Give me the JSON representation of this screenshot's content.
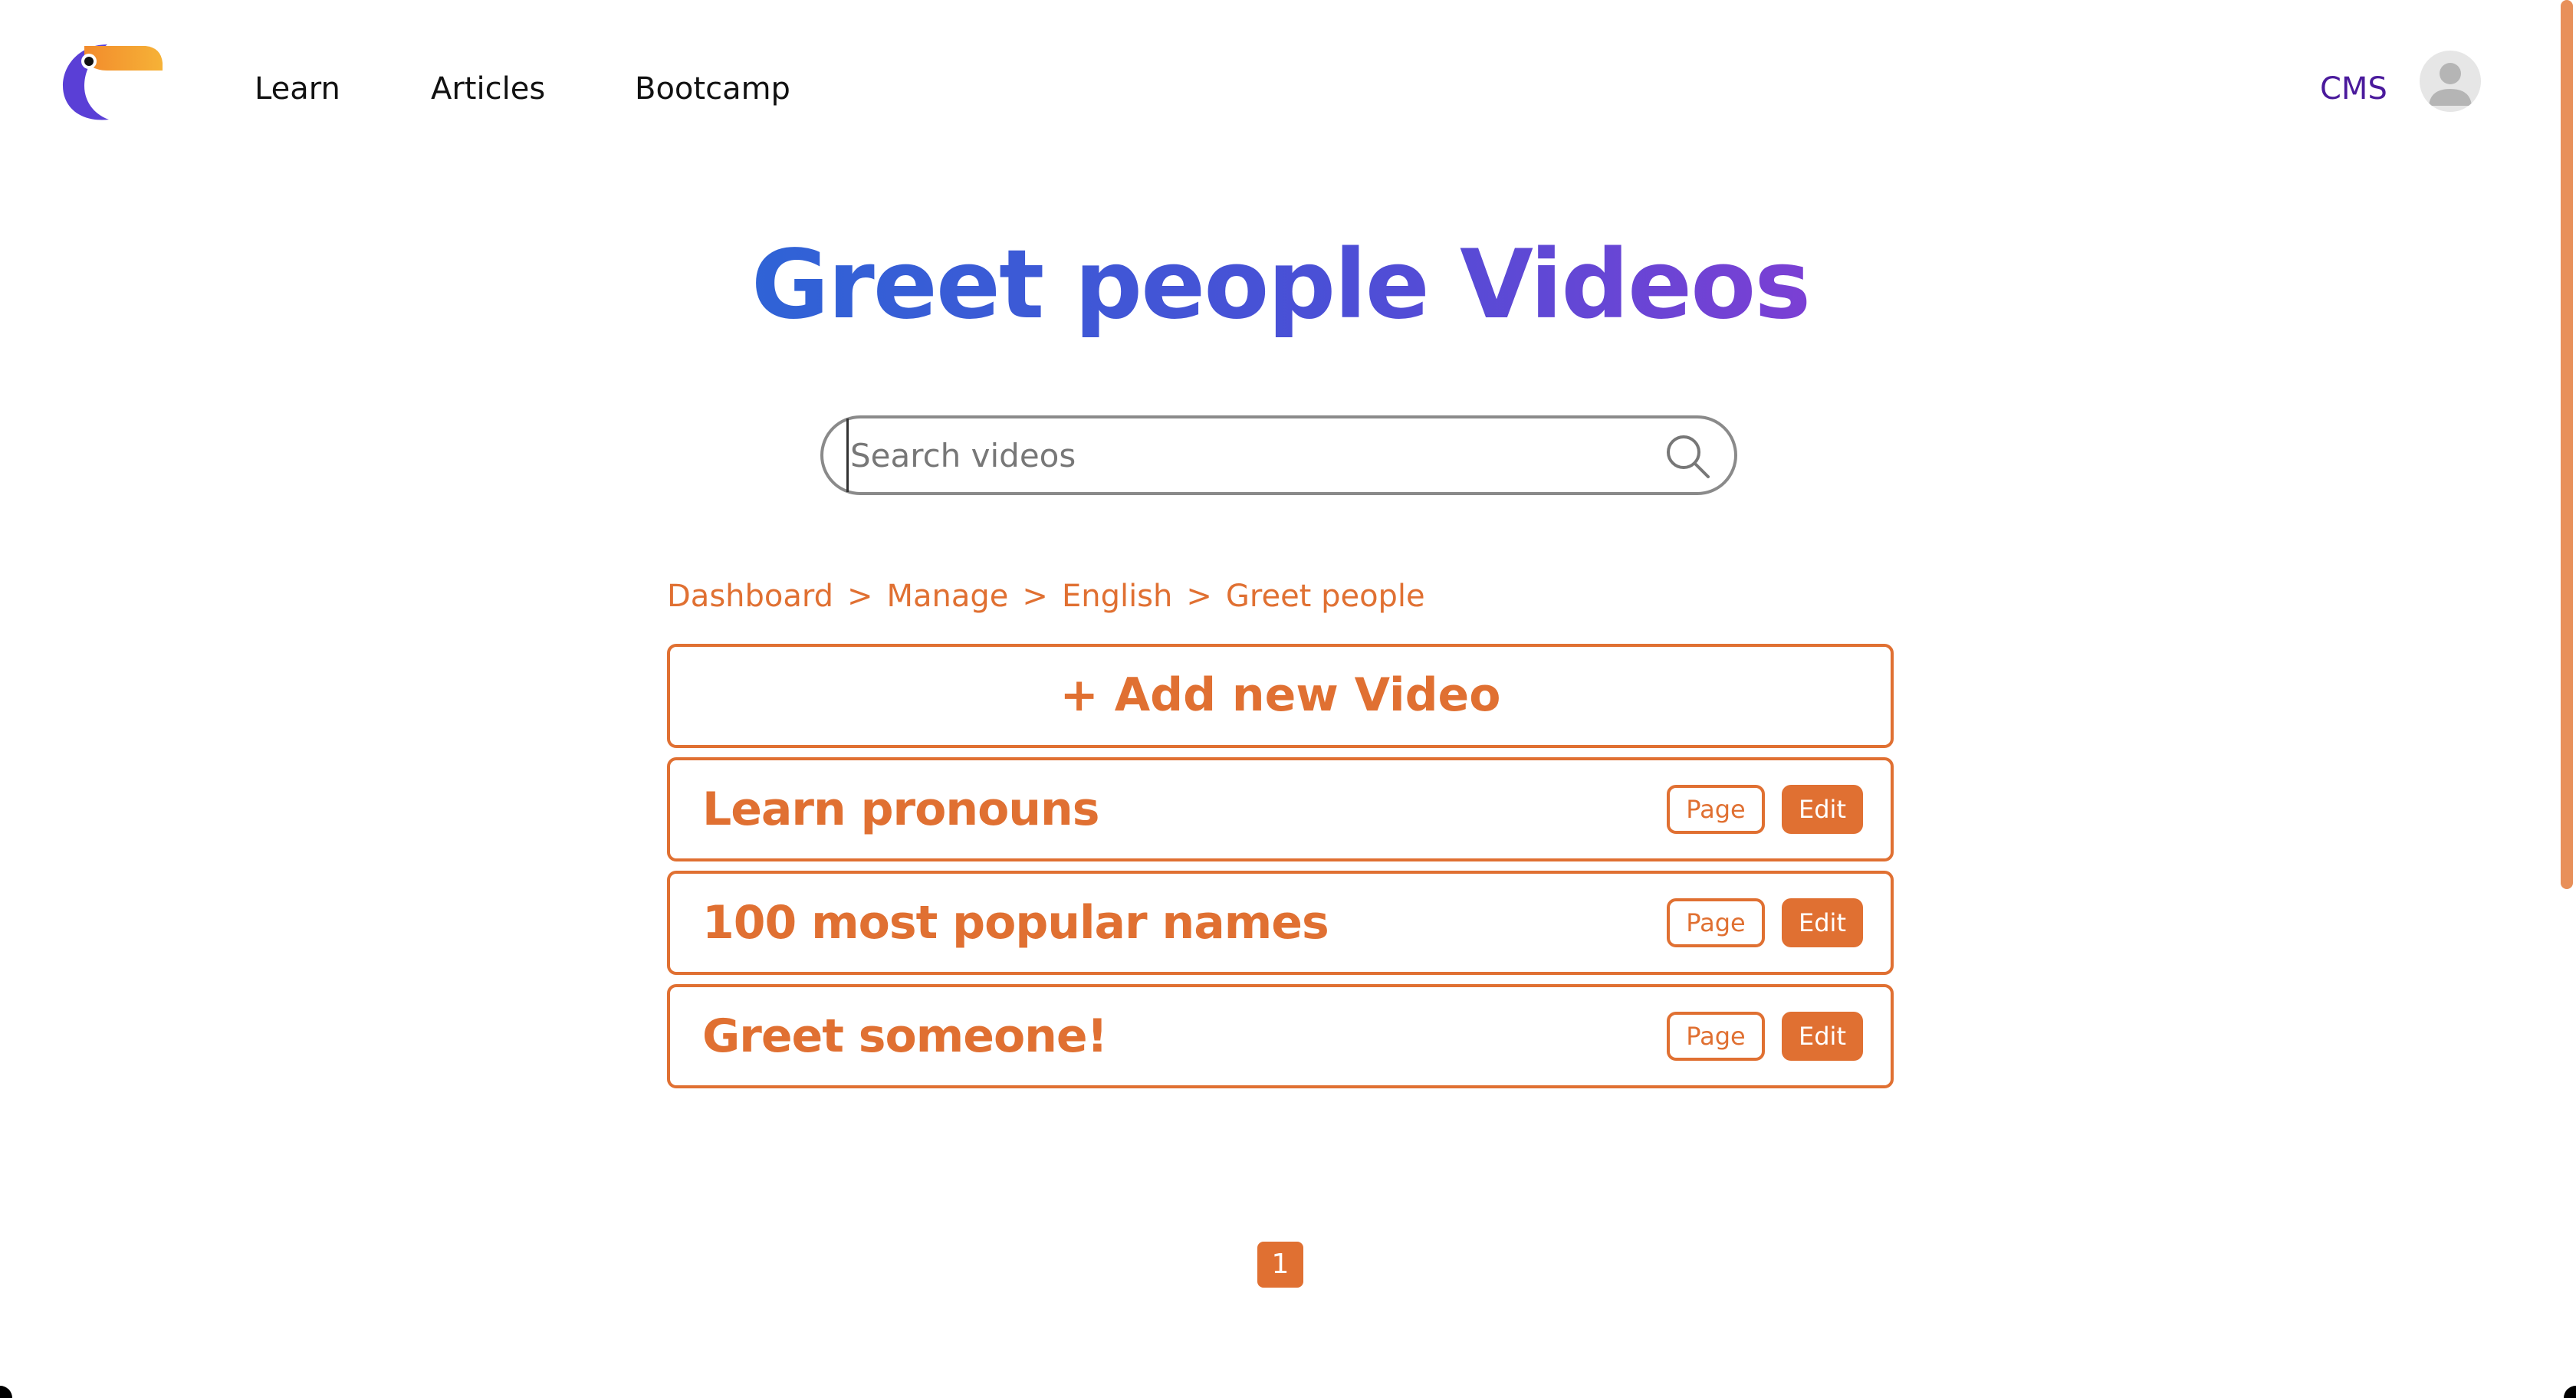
{
  "header": {
    "logo_icon": "toucan-logo-icon",
    "nav": [
      "Learn",
      "Articles",
      "Bootcamp"
    ],
    "cms_label": "CMS",
    "avatar_icon": "user-avatar-icon"
  },
  "title": "Greet people Videos",
  "search": {
    "placeholder": "Search videos",
    "value": "",
    "icon": "search-icon"
  },
  "breadcrumb": [
    "Dashboard",
    "Manage",
    "English",
    "Greet people"
  ],
  "breadcrumb_separator": ">",
  "add_button_label": "+ Add new Video",
  "videos": [
    {
      "title": "Learn pronouns",
      "page_label": "Page",
      "edit_label": "Edit"
    },
    {
      "title": "100 most popular names",
      "page_label": "Page",
      "edit_label": "Edit"
    },
    {
      "title": "Greet someone!",
      "page_label": "Page",
      "edit_label": "Edit"
    }
  ],
  "pagination": {
    "current_page": "1"
  },
  "colors": {
    "accent": "#e07032",
    "title_gradient_start": "#2f63d6",
    "title_gradient_end": "#7b3fd4",
    "cms": "#4a1a9c",
    "scrollbar": "#e8905a"
  }
}
